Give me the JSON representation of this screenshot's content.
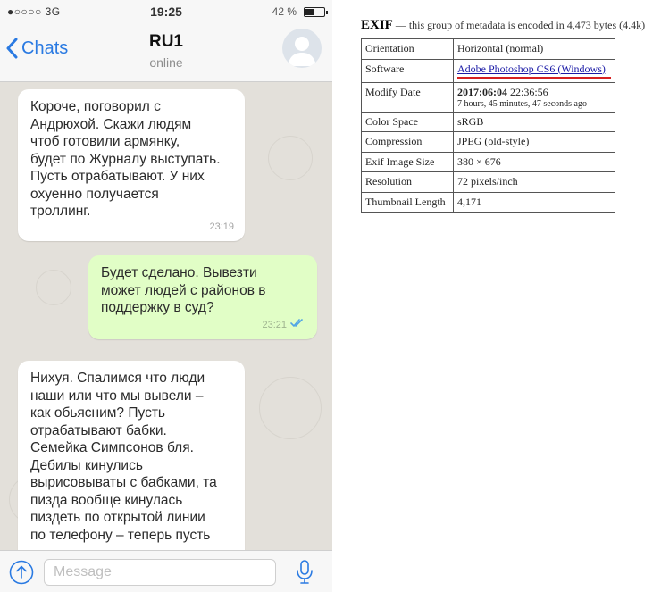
{
  "status_bar": {
    "signal": "●○○○○ 3G",
    "time": "19:25",
    "battery_text": "42 %"
  },
  "nav": {
    "back_label": "Chats",
    "title": "RU1",
    "subtitle": "online"
  },
  "messages": [
    {
      "direction": "incoming",
      "text": "Короче, поговорил с\nАндрюхой. Скажи людям\nчтоб готовили армянку,\nбудет по Журналу выступать.\nПусть отрабатывают. У них\nохуенно получается\nтроллинг.",
      "time": "23:19"
    },
    {
      "direction": "outgoing",
      "text": "Будет сделано. Вывезти\nможет людей с районов в\nподдержку в суд?",
      "time": "23:21",
      "status": "read"
    },
    {
      "direction": "incoming",
      "text": "Нихуя. Спалимся что люди\nнаши или что мы вывели –\nкак обьясним? Пусть\nотрабатывают бабки.\nСемейка Симпсонов бля.\nДебилы кинулись\nвырисовываты с бабками, та\nпизда вообще кинулась\nпиздеть по открытой линии\nпо телефону – теперь пусть"
    }
  ],
  "input_bar": {
    "placeholder": "Message"
  },
  "exif": {
    "title": "EXIF",
    "description": "— this group of metadata is encoded in 4,473 bytes (4.4k)",
    "rows": [
      {
        "key": "Orientation",
        "value": "Horizontal (normal)"
      },
      {
        "key": "Software",
        "value": "Adobe Photoshop CS6 (Windows)"
      },
      {
        "key": "Modify Date",
        "value_bold": "2017:06:04",
        "value": "22:36:56",
        "value_sub": "7 hours, 45 minutes, 47 seconds ago"
      },
      {
        "key": "Color Space",
        "value": "sRGB"
      },
      {
        "key": "Compression",
        "value": "JPEG (old-style)"
      },
      {
        "key": "Exif Image Size",
        "value": "380 × 676"
      },
      {
        "key": "Resolution",
        "value": "72 pixels/inch"
      },
      {
        "key": "Thumbnail Length",
        "value": "4,171"
      }
    ]
  },
  "colors": {
    "ios_blue": "#2a7ae2",
    "outgoing_bubble": "#e1fec6",
    "incoming_bubble": "#ffffff",
    "chat_background": "#e3e0da",
    "read_ticks": "#4fa3e6",
    "highlight_underline": "#d61f1f"
  },
  "icons": {
    "back": "chevron-left-icon",
    "avatar": "user-silhouette",
    "attach": "upload-arrow-circle-icon",
    "mic": "microphone-icon",
    "read_status": "double-check-icon",
    "battery": "battery-icon"
  }
}
